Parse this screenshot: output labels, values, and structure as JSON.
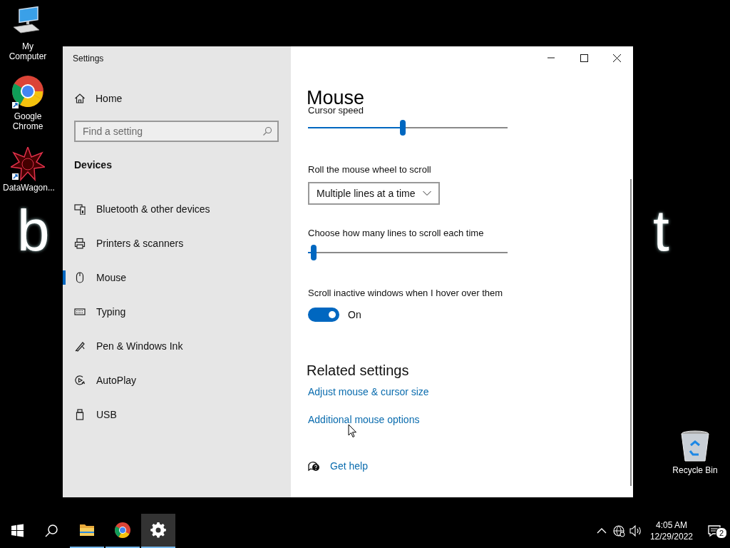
{
  "desktop": {
    "wallpaper_text": [
      "b",
      "t"
    ],
    "icons": [
      {
        "label": "My Computer",
        "kind": "computer"
      },
      {
        "label": "Google Chrome",
        "kind": "chrome"
      },
      {
        "label": "DataWagon...",
        "kind": "datawagon"
      },
      {
        "label": "Recycle Bin",
        "kind": "recycle"
      }
    ]
  },
  "window": {
    "title": "Settings",
    "sidebar": {
      "home": "Home",
      "search": {
        "placeholder": "Find a setting"
      },
      "section": "Devices",
      "items": [
        {
          "label": "Bluetooth & other devices",
          "kind": "bluetooth",
          "selected": false
        },
        {
          "label": "Printers & scanners",
          "kind": "printer",
          "selected": false
        },
        {
          "label": "Mouse",
          "kind": "mouse",
          "selected": true
        },
        {
          "label": "Typing",
          "kind": "keyboard",
          "selected": false
        },
        {
          "label": "Pen & Windows Ink",
          "kind": "pen",
          "selected": false
        },
        {
          "label": "AutoPlay",
          "kind": "autoplay",
          "selected": false
        },
        {
          "label": "USB",
          "kind": "usb",
          "selected": false
        }
      ]
    },
    "content": {
      "heading": "Mouse",
      "settings": [
        {
          "kind": "slider",
          "label": "Cursor speed",
          "level": 0.475
        },
        {
          "kind": "dropdown",
          "label": "Roll the mouse wheel to scroll",
          "value": "Multiple lines at a time"
        },
        {
          "kind": "slider",
          "label": "Choose how many lines to scroll each time",
          "level": 0.03
        },
        {
          "kind": "toggle",
          "label": "Scroll inactive windows when I hover over them",
          "on": true,
          "state_text": "On"
        }
      ],
      "related": {
        "title": "Related settings",
        "links": [
          "Adjust mouse & cursor size",
          "Additional mouse options"
        ]
      },
      "help": "Get help"
    }
  },
  "taskbar": {
    "apps": [
      {
        "kind": "explorer",
        "running": true,
        "selected": false
      },
      {
        "kind": "chrome",
        "running": true,
        "selected": false
      },
      {
        "kind": "settings",
        "running": true,
        "selected": true
      }
    ],
    "clock": {
      "time": "4:05 AM",
      "date": "12/29/2022"
    },
    "notifications": "2"
  }
}
